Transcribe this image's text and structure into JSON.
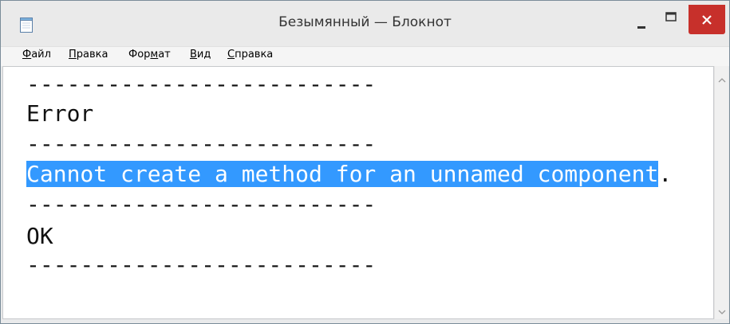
{
  "window": {
    "title": "Безымянный — Блокнот"
  },
  "menu": {
    "items": [
      {
        "label_underlined": "Ф",
        "label_rest": "айл"
      },
      {
        "label_underlined": "П",
        "label_rest": "равка"
      },
      {
        "label_pre": "Фор",
        "label_underlined": "м",
        "label_rest": "ат"
      },
      {
        "label_underlined": "В",
        "label_rest": "ид"
      },
      {
        "label_underlined": "С",
        "label_rest": "правка"
      }
    ]
  },
  "editor": {
    "lines": [
      "--------------------------",
      "Error",
      "--------------------------",
      "--------------------------",
      "OK",
      "--------------------------"
    ],
    "selected_text": "Cannot create a method for an unnamed component",
    "after_selection": "."
  },
  "colors": {
    "selection": "#3399ff",
    "close_button": "#c7302b"
  },
  "icons": {
    "app": "notepad-icon",
    "minimize": "minimize-icon",
    "maximize": "maximize-icon",
    "close": "close-icon",
    "scroll_up": "chevron-up-icon",
    "scroll_down": "chevron-down-icon"
  }
}
